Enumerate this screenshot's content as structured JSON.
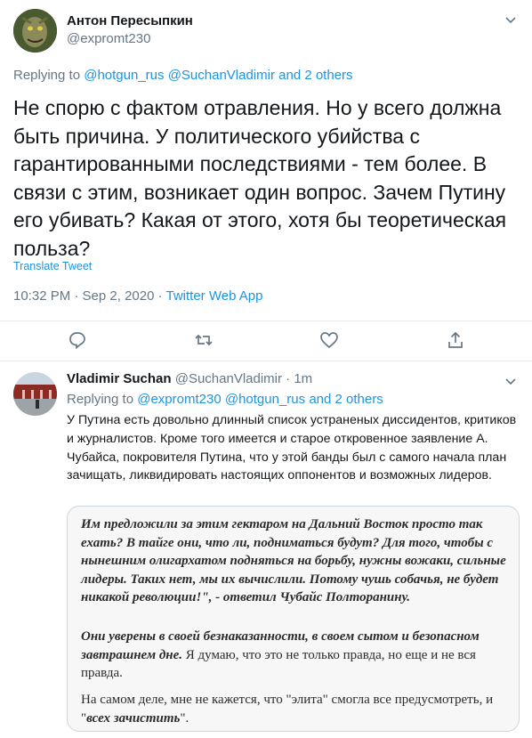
{
  "main_tweet": {
    "author_name": "Антон Пересыпкин",
    "author_handle": "@expromt230",
    "replying_prefix": "Replying to ",
    "replying_user1": "@hotgun_rus",
    "replying_user2": "@SuchanVladimir",
    "replying_others": "and 2 others",
    "text": "Не спорю с фактом отравления. Но у всего должна быть причина. У политического убийства с гарантированными последствиями - тем более. В связи с этим, возникает один вопрос. Зачем Путину его убивать? Какая от этого, хотя бы теоретическая польза?",
    "translate_label": "Translate Tweet",
    "timestamp": "10:32 PM · Sep 2, 2020 · ",
    "source": "Twitter Web App"
  },
  "reply_tweet": {
    "author_name": "Vladimir Suchan",
    "author_handle": "@SuchanVladimir",
    "separator": " · ",
    "time": "1m",
    "replying_prefix": "Replying to ",
    "replying_user1": "@expromt230",
    "replying_user2": "@hotgun_rus",
    "replying_others": "and 2 others",
    "text": "У Путина есть довольно длинный список устраненых диссидентов, критиков и журналистов. Кроме того имеется и старое откровенное заявление А. Чубайса, покровителя Путина, что у этой банды был с самого начала план зачищать, ликвидировать настоящих оппонентов и возможных лидеров.",
    "image_text": {
      "p1": "Им предложили за этим гектаром на Дальний Восток просто так ехать? В тайге они, что ли, подниматься будут? Для того, чтобы с нынешним олигархатом подняться на борьбу, нужны вожаки, сильные лидеры. Таких нет, мы их вычислили. Потому чушь собачья, не будет никакой революции!\", - ответил Чубайс Полторанину.",
      "p2_bold": "Они уверены в своей безнаказанности, в своем сытом и безопасном завтрашнем дне.",
      "p2_rest": " Я думаю, что это не только правда, но еще и не вся правда.",
      "p3_start": "На самом деле, мне не кажется, что \"элита\" смогла все предусмотреть, и \"",
      "p3_bold": "всех зачистить",
      "p3_end": "\"."
    }
  },
  "colors": {
    "text": "#14171a",
    "muted": "#657786",
    "link": "#1b95e0",
    "divider": "#e6ecf0"
  },
  "icons": [
    "caret-down-icon",
    "reply-icon",
    "retweet-icon",
    "like-icon",
    "share-icon"
  ]
}
